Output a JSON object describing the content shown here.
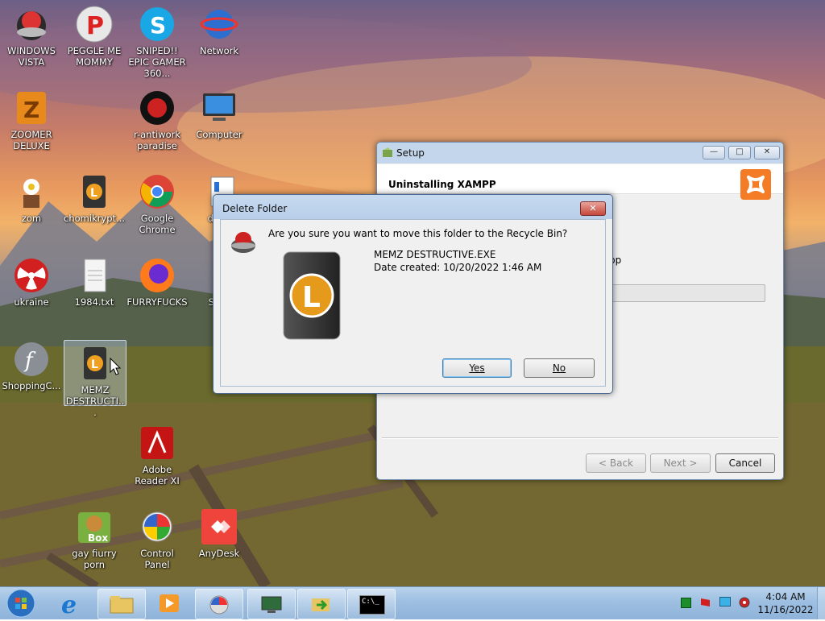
{
  "desktop": {
    "icons": [
      {
        "label": "WINDOWS VISTA"
      },
      {
        "label": "PEGGLE ME MOMMY"
      },
      {
        "label": "SNIPED!! EPIC GAMER 360..."
      },
      {
        "label": "Network"
      },
      {
        "label": "ZOOMER DELUXE"
      },
      {
        "label": "r-antiwork paradise"
      },
      {
        "label": "Computer"
      },
      {
        "label": "zom"
      },
      {
        "label": "chomikrypt..."
      },
      {
        "label": "Google Chrome"
      },
      {
        "label": "dig..."
      },
      {
        "label": "ukraine"
      },
      {
        "label": "1984.txt"
      },
      {
        "label": "FURRYFUCKS"
      },
      {
        "label": "SO..."
      },
      {
        "label": "ShoppingC..."
      },
      {
        "label": "MEMZ DESTRUCTI..."
      },
      {
        "label": "Adobe Reader XI"
      },
      {
        "label": "gay fiurry porn"
      },
      {
        "label": "Control Panel"
      },
      {
        "label": "AnyDesk"
      }
    ]
  },
  "setup_window": {
    "title": "Setup",
    "header": "Uninstalling XAMPP",
    "status_fragment": "pp",
    "back_button": "< Back",
    "next_button": "Next >",
    "cancel_button": "Cancel",
    "minimize_glyph": "—",
    "maximize_glyph": "□",
    "close_glyph": "✕"
  },
  "delete_dialog": {
    "title": "Delete Folder",
    "question": "Are you sure you want to move this folder to the Recycle Bin?",
    "item_name": "MEMZ DESTRUCTIVE.EXE",
    "item_date": "Date created: 10/20/2022 1:46 AM",
    "yes_button": "Yes",
    "no_button": "No",
    "close_glyph": "✕"
  },
  "taskbar": {
    "time": "4:04 AM",
    "date": "11/16/2022",
    "cmd_glyph": "C:\\_"
  },
  "colors": {
    "accent_orange": "#f57c26",
    "taskbar_blue": "#9dbfe2"
  }
}
